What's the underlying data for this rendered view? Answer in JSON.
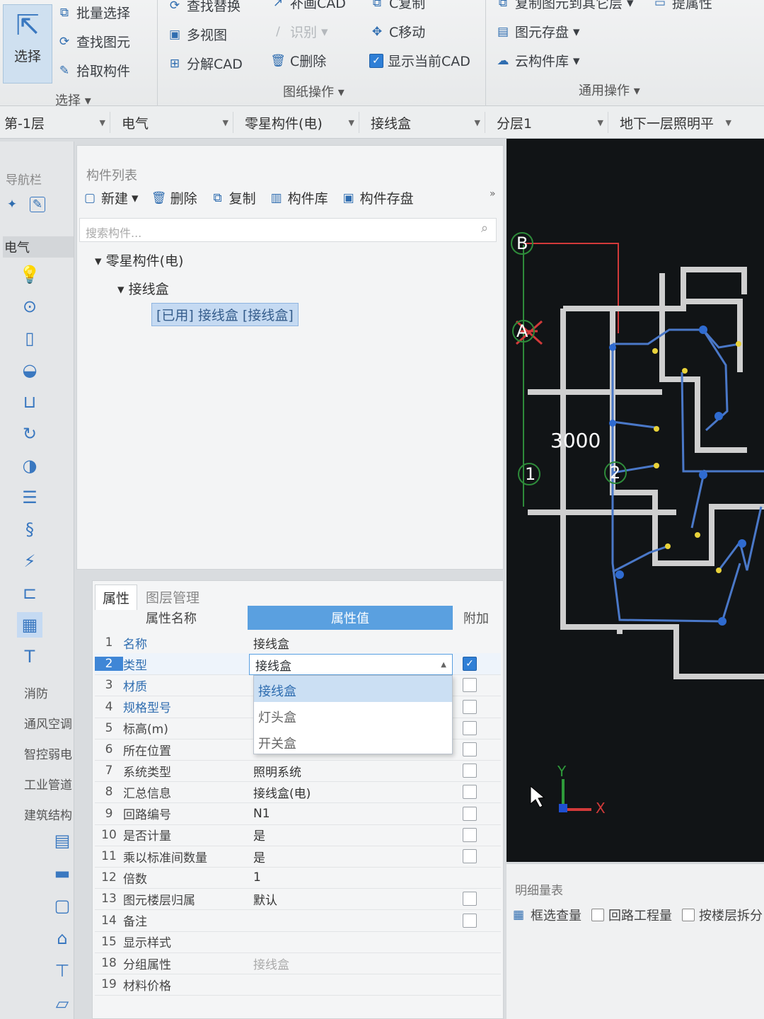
{
  "ribbon": {
    "select_label": "选择",
    "col1": [
      "批量选择",
      "查找图元",
      "拾取构件"
    ],
    "col2": [
      "查找替换",
      "多视图",
      "分解CAD"
    ],
    "col3": [
      "补画CAD",
      "识别",
      "C删除"
    ],
    "col4": [
      "C复制",
      "C移动",
      "显示当前CAD"
    ],
    "col5": [
      "复制图元到其它层",
      "图元存盘",
      "云构件库"
    ],
    "col6": "提属性",
    "group_select": "选择",
    "group_drawing": "图纸操作",
    "group_common": "通用操作"
  },
  "selectors": {
    "floor": "第-1层",
    "discipline": "电气",
    "category": "零星构件(电)",
    "component": "接线盒",
    "layer": "分层1",
    "drawing": "地下一层照明平"
  },
  "nav": {
    "title": "导航栏",
    "active_category": "电气",
    "categories": [
      "消防",
      "通风空调",
      "智控弱电",
      "工业管道",
      "建筑结构"
    ]
  },
  "component_list": {
    "title": "构件列表",
    "toolbar": [
      "新建",
      "删除",
      "复制",
      "构件库",
      "构件存盘"
    ],
    "search_placeholder": "搜索构件...",
    "tree_root": "零星构件(电)",
    "tree_child": "接线盒",
    "tree_leaf": "[已用] 接线盒 [接线盒]"
  },
  "properties": {
    "tabs": [
      "属性",
      "图层管理"
    ],
    "headers": [
      "属性名称",
      "属性值",
      "附加"
    ],
    "rows": [
      {
        "num": "1",
        "name": "名称",
        "value": "接线盒",
        "checked": null,
        "blue": true
      },
      {
        "num": "2",
        "name": "类型",
        "value": "接线盒",
        "checked": true,
        "blue": true
      },
      {
        "num": "3",
        "name": "材质",
        "value": "",
        "checked": false,
        "blue": true
      },
      {
        "num": "4",
        "name": "规格型号",
        "value": "",
        "checked": false,
        "blue": true
      },
      {
        "num": "5",
        "name": "标高(m)",
        "value": "",
        "checked": false,
        "blue": false
      },
      {
        "num": "6",
        "name": "所在位置",
        "value": "",
        "checked": false,
        "blue": false
      },
      {
        "num": "7",
        "name": "系统类型",
        "value": "照明系统",
        "checked": false,
        "blue": false
      },
      {
        "num": "8",
        "name": "汇总信息",
        "value": "接线盒(电)",
        "checked": false,
        "blue": false
      },
      {
        "num": "9",
        "name": "回路编号",
        "value": "N1",
        "checked": false,
        "blue": false
      },
      {
        "num": "10",
        "name": "是否计量",
        "value": "是",
        "checked": false,
        "blue": false
      },
      {
        "num": "11",
        "name": "乘以标准间数量",
        "value": "是",
        "checked": false,
        "blue": false
      },
      {
        "num": "12",
        "name": "倍数",
        "value": "1",
        "checked": null,
        "blue": false
      },
      {
        "num": "13",
        "name": "图元楼层归属",
        "value": "默认",
        "checked": false,
        "blue": false
      },
      {
        "num": "14",
        "name": "备注",
        "value": "",
        "checked": false,
        "blue": false
      },
      {
        "num": "15",
        "name": "显示样式",
        "value": "",
        "checked": null,
        "blue": false
      },
      {
        "num": "18",
        "name": "分组属性",
        "value": "接线盒",
        "checked": null,
        "blue": false
      },
      {
        "num": "19",
        "name": "材料价格",
        "value": "",
        "checked": null,
        "blue": false
      }
    ],
    "dropdown_options": [
      "接线盒",
      "灯头盒",
      "开关盒"
    ]
  },
  "cad": {
    "dimension": "3000",
    "axis_labels": [
      "B",
      "A",
      "1",
      "2"
    ],
    "axis_x": "X",
    "axis_y": "Y"
  },
  "bottom": {
    "title": "明细量表",
    "buttons": [
      "框选查量",
      "回路工程量",
      "按楼层拆分"
    ]
  }
}
